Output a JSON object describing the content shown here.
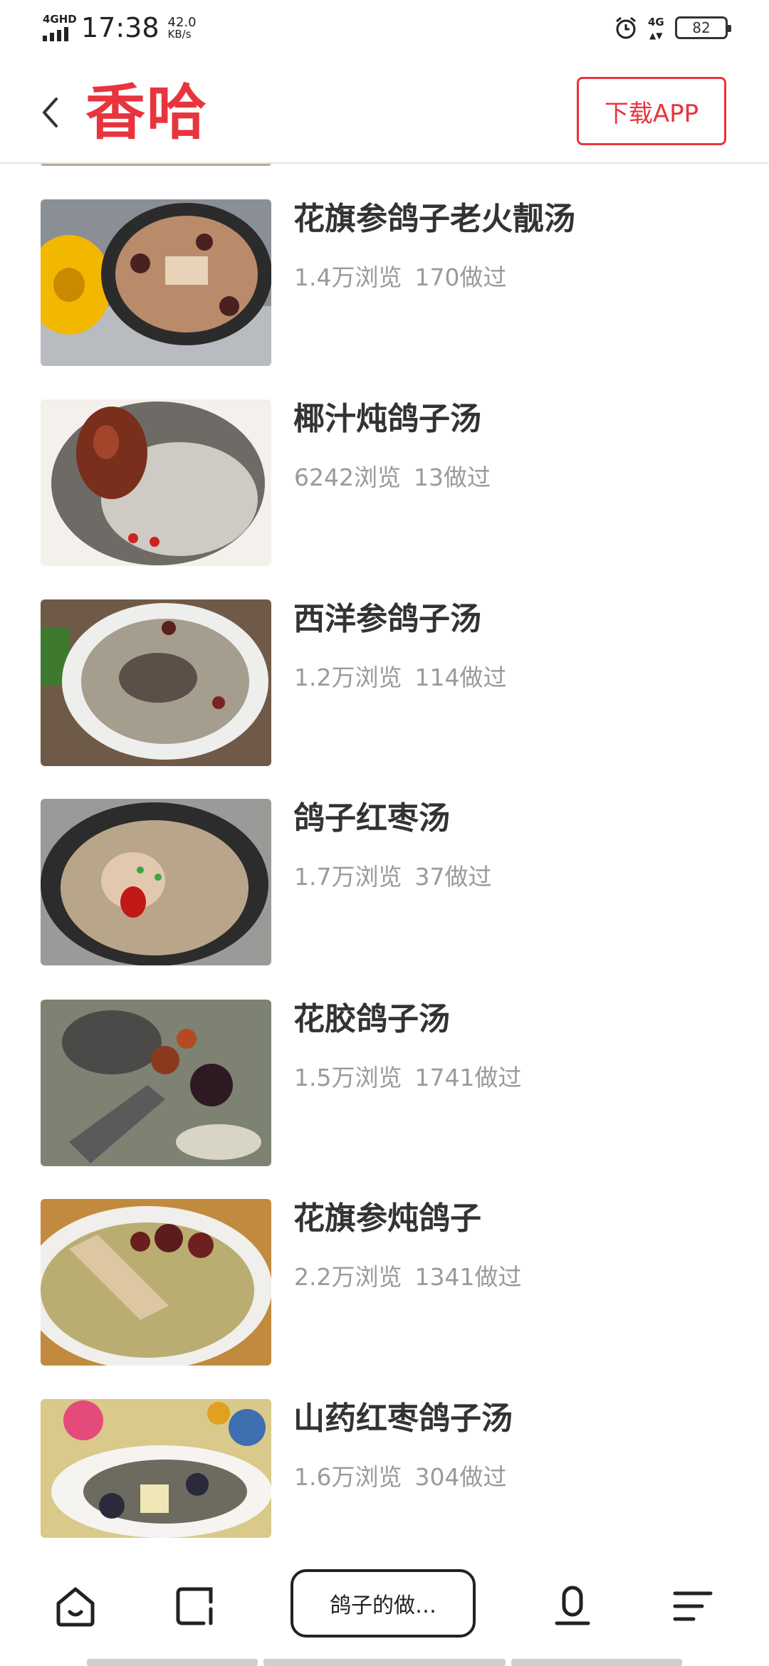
{
  "status_bar": {
    "network_type": "4GHD",
    "time": "17:38",
    "speed_value": "42.0",
    "speed_unit": "KB/s",
    "data_network": "4G",
    "battery": "82"
  },
  "header": {
    "logo": "香哈",
    "download_button": "下载APP",
    "accent_color": "#e8343d"
  },
  "recipes": [
    {
      "title": "花旗参鸽子老火靓汤",
      "views": "1.4万浏览",
      "made": "170做过"
    },
    {
      "title": "椰汁炖鸽子汤",
      "views": "6242浏览",
      "made": "13做过"
    },
    {
      "title": "西洋参鸽子汤",
      "views": "1.2万浏览",
      "made": "114做过"
    },
    {
      "title": "鸽子红枣汤",
      "views": "1.7万浏览",
      "made": "37做过"
    },
    {
      "title": "花胶鸽子汤",
      "views": "1.5万浏览",
      "made": "1741做过"
    },
    {
      "title": "花旗参炖鸽子",
      "views": "2.2万浏览",
      "made": "1341做过"
    },
    {
      "title": "山药红枣鸽子汤",
      "views": "1.6万浏览",
      "made": "304做过"
    }
  ],
  "bottom_bar": {
    "search_text": "鸽子的做…",
    "icons": [
      "home-icon",
      "tabs-icon",
      "microphone-icon",
      "menu-icon"
    ]
  }
}
